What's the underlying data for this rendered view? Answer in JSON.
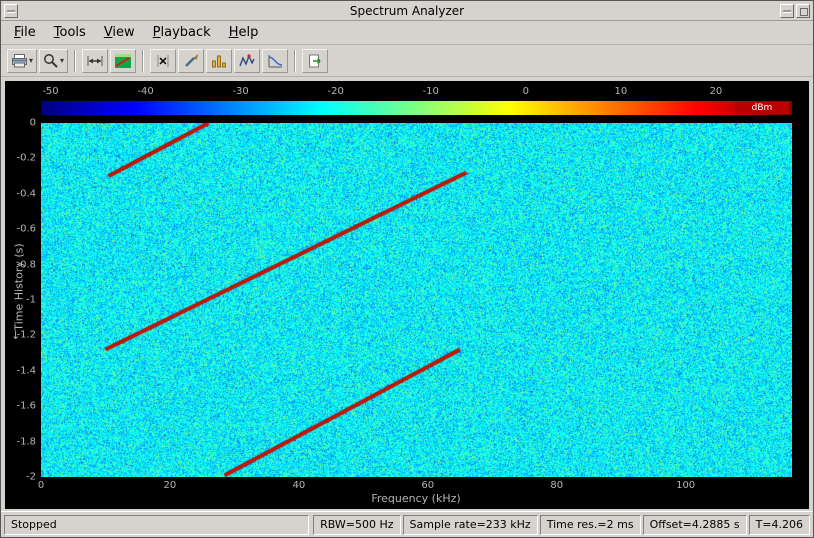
{
  "window": {
    "title": "Spectrum Analyzer",
    "controls": [
      "window-menu",
      "minimize",
      "maximize"
    ]
  },
  "menu": {
    "items": [
      "File",
      "Tools",
      "View",
      "Playback",
      "Help"
    ]
  },
  "toolbar": {
    "buttons": [
      {
        "name": "print-export-button",
        "icon": "printer-icon",
        "has_dropdown": true
      },
      {
        "name": "zoom-button",
        "icon": "magnifier-icon",
        "has_dropdown": true
      },
      {
        "name": "span-x-button",
        "icon": "horizontal-arrows-icon",
        "has_dropdown": false
      },
      {
        "name": "spectrogram-view-button",
        "icon": "spectrogram-icon",
        "has_dropdown": false
      },
      {
        "name": "cursor-measurements-button",
        "icon": "cursors-x-icon",
        "has_dropdown": false
      },
      {
        "name": "signal-statistics-button",
        "icon": "pencil-ruler-icon",
        "has_dropdown": false
      },
      {
        "name": "distortion-measurements-button",
        "icon": "yellow-bars-icon",
        "has_dropdown": false
      },
      {
        "name": "peak-finder-button",
        "icon": "peak-trace-icon",
        "has_dropdown": false
      },
      {
        "name": "ccdf-measurements-button",
        "icon": "curve-axes-icon",
        "has_dropdown": false
      },
      {
        "name": "step-forward-button",
        "icon": "page-arrow-icon",
        "has_dropdown": false
      }
    ]
  },
  "colorbar": {
    "ticks": [
      "-50",
      "-40",
      "-30",
      "-20",
      "-10",
      "0",
      "10",
      "20"
    ],
    "unit": "dBm"
  },
  "axes": {
    "x": {
      "label": "Frequency (kHz)",
      "ticks": [
        "0",
        "20",
        "40",
        "60",
        "80",
        "100"
      ]
    },
    "y": {
      "label": "Time History (s)",
      "direction_arrow": "↓",
      "ticks": [
        "0",
        "-0.2",
        "-0.4",
        "-0.6",
        "-0.8",
        "-1",
        "-1.2",
        "-1.4",
        "-1.6",
        "-1.8",
        "-2"
      ]
    }
  },
  "chart_data": {
    "type": "heatmap",
    "title": "",
    "xlabel": "Frequency (kHz)",
    "ylabel": "Time History (s)",
    "x_range_khz": [
      0,
      116.5
    ],
    "y_range_s": [
      0,
      -2
    ],
    "color_range_dbm": [
      -51,
      28
    ],
    "noise_floor_dbm": -22,
    "noise_std_db": 5,
    "signal_level_dbm": 22,
    "chirp_segments": [
      {
        "f0_khz": 10.5,
        "t0_s": -0.3,
        "f1_khz": 26.0,
        "t1_s": 0.0
      },
      {
        "f0_khz": 10.0,
        "t0_s": -1.28,
        "f1_khz": 66.0,
        "t1_s": -0.28
      },
      {
        "f0_khz": 28.5,
        "t0_s": -1.99,
        "f1_khz": 65.0,
        "t1_s": -1.28
      }
    ]
  },
  "status_bar": {
    "state": "Stopped",
    "fields": [
      "RBW=500 Hz",
      "Sample rate=233 kHz",
      "Time res.=2 ms",
      "Offset=4.2885 s",
      "T=4.206"
    ]
  }
}
